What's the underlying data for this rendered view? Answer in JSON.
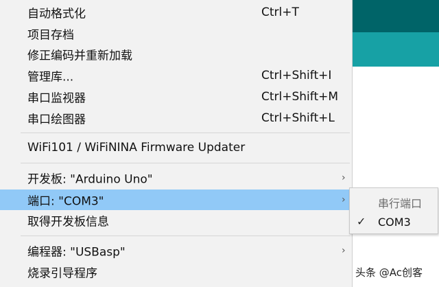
{
  "menu": {
    "items": [
      {
        "label": "自动格式化",
        "shortcut": "Ctrl+T"
      },
      {
        "label": "项目存档",
        "shortcut": ""
      },
      {
        "label": "修正编码并重新加载",
        "shortcut": ""
      },
      {
        "label": "管理库...",
        "shortcut": "Ctrl+Shift+I"
      },
      {
        "label": "串口监视器",
        "shortcut": "Ctrl+Shift+M"
      },
      {
        "label": "串口绘图器",
        "shortcut": "Ctrl+Shift+L"
      },
      {
        "label": "WiFi101 / WiFiNINA Firmware Updater"
      },
      {
        "label": "开发板: \"Arduino Uno\""
      },
      {
        "label": "端口: \"COM3\""
      },
      {
        "label": "取得开发板信息"
      },
      {
        "label": "编程器: \"USBasp\""
      },
      {
        "label": "烧录引导程序"
      }
    ],
    "submenu_arrow": "›"
  },
  "port_submenu": {
    "header": "串行端口",
    "items": [
      {
        "label": "COM3",
        "checked": true,
        "check_symbol": "✓"
      }
    ]
  },
  "watermark": "头条 @Ac创客",
  "colors": {
    "menu_bg": "#f2f2f2",
    "highlight": "#91c9f7",
    "header_dark": "#006468",
    "header_teal": "#17a1a5"
  }
}
